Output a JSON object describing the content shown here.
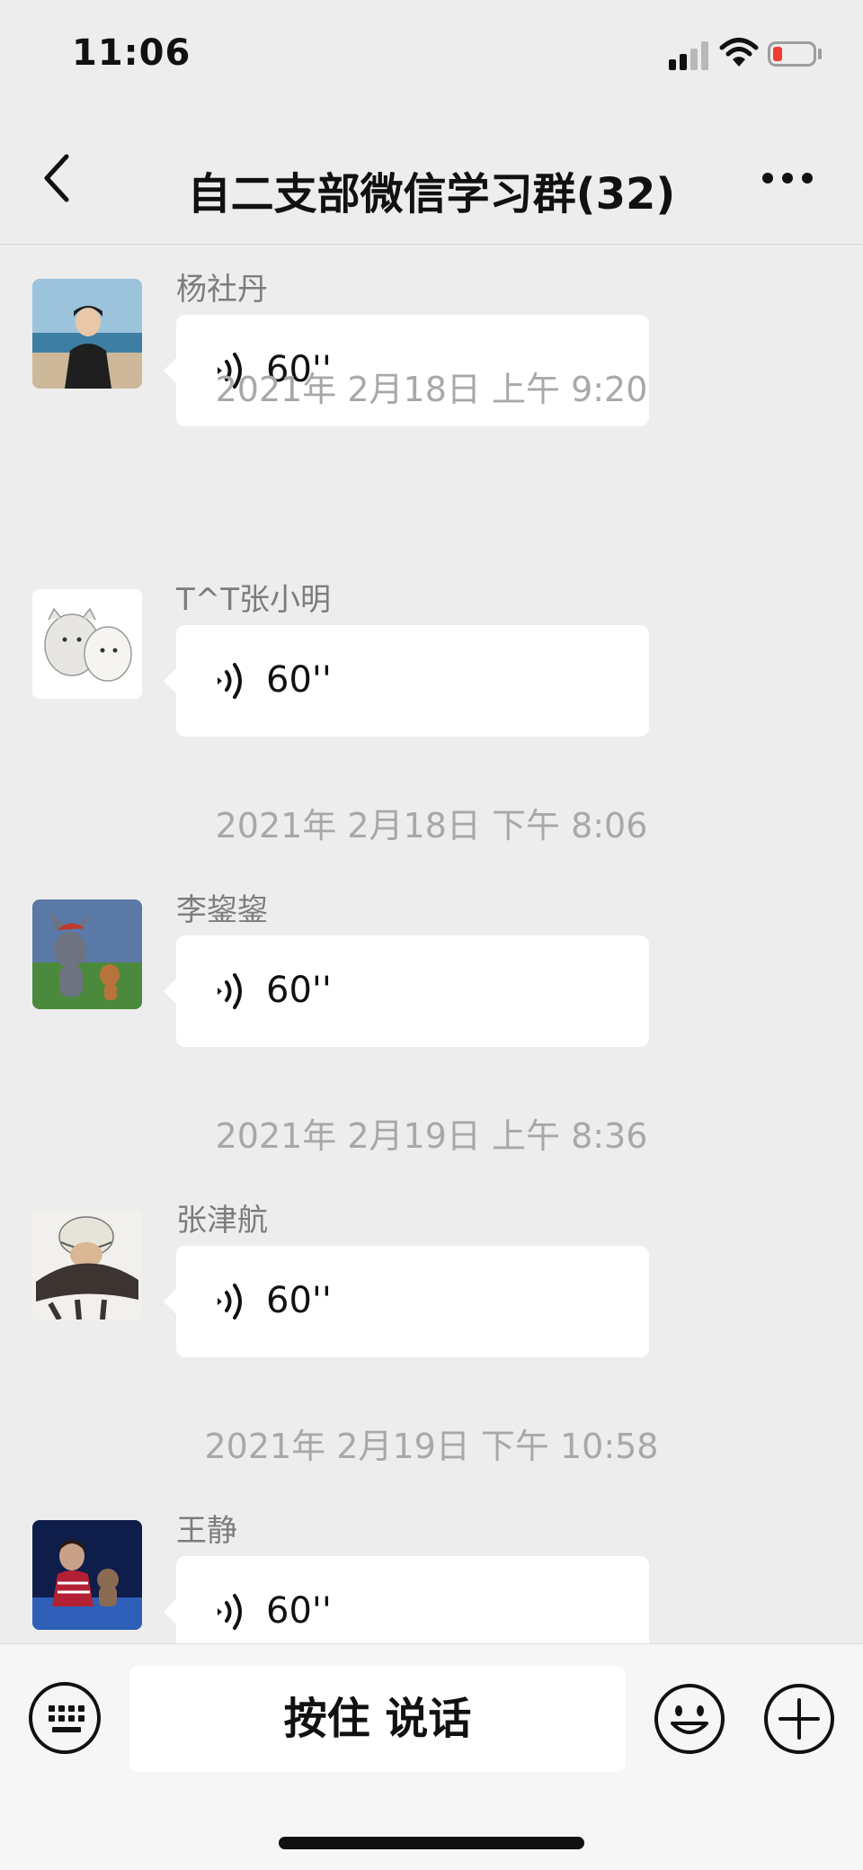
{
  "status_bar": {
    "time": "11:06"
  },
  "nav": {
    "title": "自二支部微信学习群(32)"
  },
  "messages": [
    {
      "sender": "杨社丹",
      "duration": "60''"
    },
    {
      "sender": "T^T张小明",
      "duration": "60''"
    },
    {
      "sender": "李鋆鋆",
      "duration": "60''"
    },
    {
      "sender": "张津航",
      "duration": "60''"
    },
    {
      "sender": "王静",
      "duration": "60''"
    }
  ],
  "timestamps": [
    "2021年 2月18日 上午 9:20",
    "2021年 2月18日 下午 8:06",
    "2021年 2月19日 上午 8:36",
    "2021年 2月19日 下午 10:58"
  ],
  "input_bar": {
    "talk_label": "按住 说话"
  },
  "icons": {
    "back": "chevron-left-icon",
    "more": "more-dots-icon",
    "voice": "voice-wave-icon",
    "keyboard": "keyboard-icon",
    "emoji": "emoji-icon",
    "plus": "plus-icon"
  }
}
